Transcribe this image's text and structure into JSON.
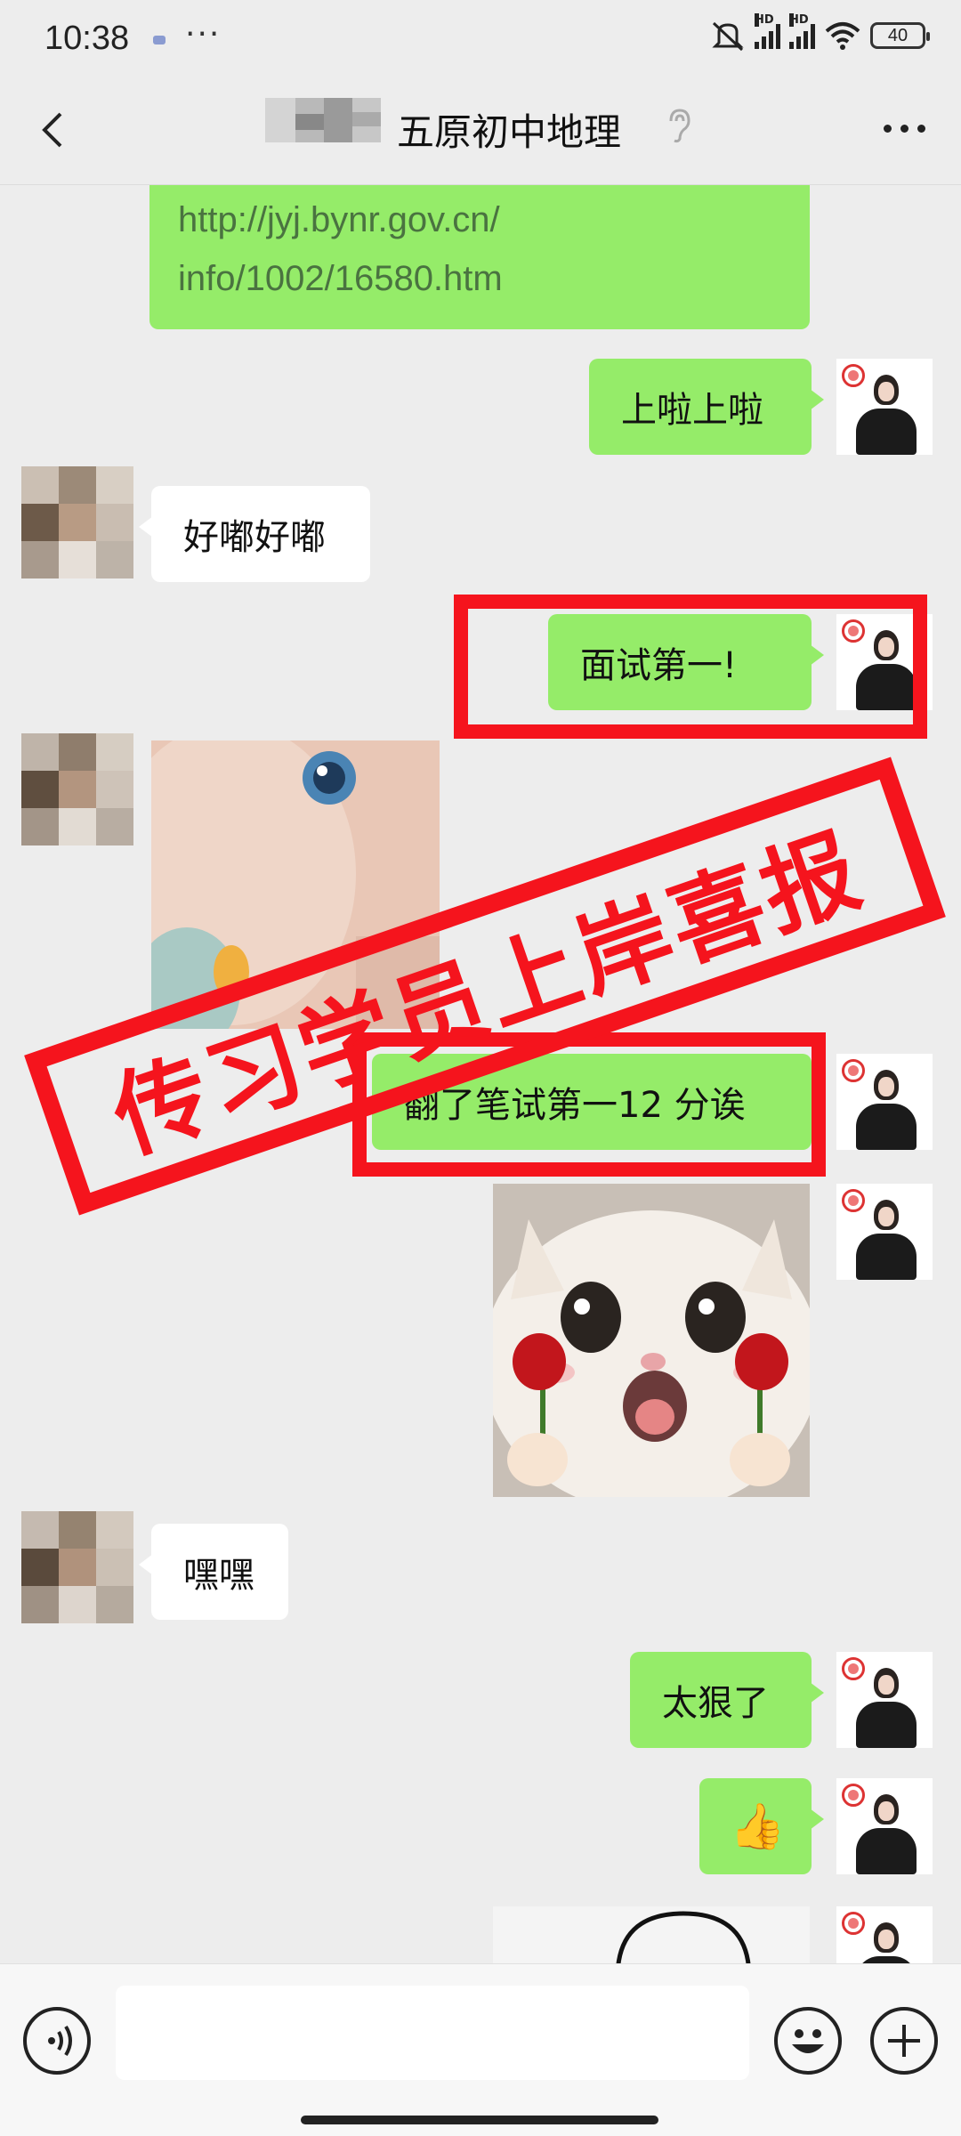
{
  "status_bar": {
    "time": "10:38",
    "dots": "···",
    "battery": "40",
    "hd_label": "HD"
  },
  "header": {
    "title": "五原初中地理",
    "back_icon": "back-chevron-icon",
    "more_icon": "more-dots-icon",
    "ear_icon": "earpiece-mode-icon"
  },
  "messages": {
    "link_line1": "http://jyj.bynr.gov.cn/",
    "link_line2": "info/1002/16580.htm",
    "msg_shangla": "上啦上啦",
    "msg_haodu": "好嘟好嘟",
    "msg_mianshi": "面试第一!",
    "msg_bishi": "翻了笔试第一12 分诶",
    "msg_heihei": "嘿嘿",
    "msg_taihen": "太狠了",
    "msg_thumbs": "👍"
  },
  "stamp": {
    "text": "传习学员上岸喜报",
    "color": "#f5141d"
  },
  "input_bar": {
    "placeholder": "",
    "voice_icon": "voice-icon",
    "emoji_icon": "emoji-icon",
    "plus_icon": "plus-icon"
  },
  "colors": {
    "bubble_green": "#95ec69",
    "bubble_white": "#ffffff",
    "background": "#ededed"
  }
}
